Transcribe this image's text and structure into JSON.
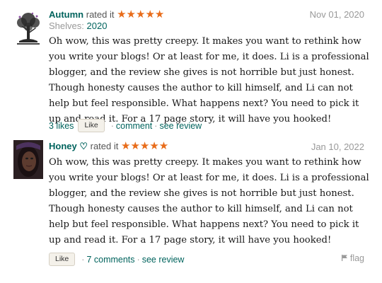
{
  "reviews": [
    {
      "username": "Autumn",
      "rated_text": "rated it",
      "stars": "★★★★★",
      "date": "Nov 01, 2020",
      "shelves_label": "Shelves:",
      "shelves_value": "2020",
      "body": "Oh wow, this was pretty creepy. It makes you want to rethink how you write your blogs! Or at least for me, it does. Li is a professional blogger, and the review she gives is not horrible but just honest. Though honesty causes the author to kill himself, and Li can not help but feel responsible. What happens next? You need to pick it up and read it. For a 17 page story, it will have you hooked!",
      "likes": "3 likes",
      "like_button": "Like",
      "comment": "comment",
      "see_review": "see review"
    },
    {
      "username": "Honey ♡",
      "rated_text": "rated it",
      "stars": "★★★★★",
      "date": "Jan 10, 2022",
      "body": "Oh wow, this was pretty creepy. It makes you want to rethink how you write your blogs! Or at least for me, it does. Li is a professional blogger, and the review she gives is not horrible but just honest. Though honesty causes the author to kill himself, and Li can not help but feel responsible. What happens next? You need to pick it up and read it. For a 17 page story, it will have you hooked!",
      "like_button": "Like",
      "comments": "7 comments",
      "see_review": "see review",
      "flag": "flag"
    }
  ],
  "colors": {
    "link": "#00635d",
    "stars": "#e86c1a",
    "muted": "#999999",
    "button_bg": "#f4f1ea"
  },
  "icons": [
    "tree-avatar",
    "profile-photo-avatar",
    "star-icon",
    "flag-icon"
  ]
}
